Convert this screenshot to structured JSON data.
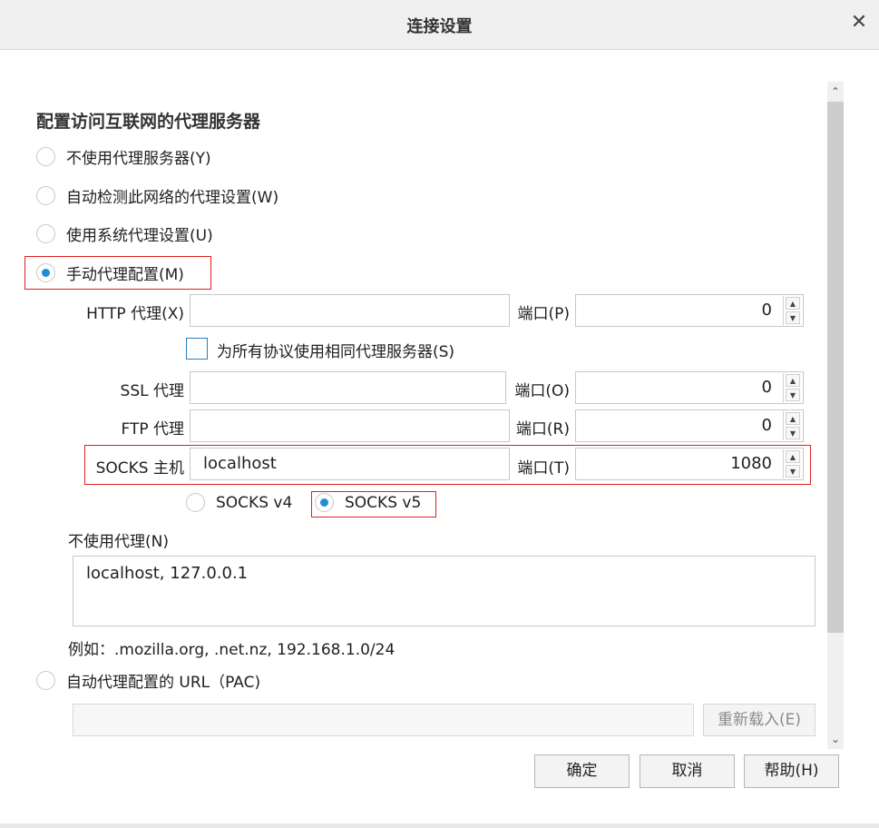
{
  "window": {
    "title": "连接设置",
    "close_glyph": "✕"
  },
  "section": {
    "title": "配置访问互联网的代理服务器"
  },
  "proxy_modes": [
    {
      "label": "不使用代理服务器(Y)",
      "checked": false
    },
    {
      "label": "自动检测此网络的代理设置(W)",
      "checked": false
    },
    {
      "label": "使用系统代理设置(U)",
      "checked": false
    },
    {
      "label": "手动代理配置(M)",
      "checked": true
    }
  ],
  "manual": {
    "http": {
      "label": "HTTP 代理(X)",
      "value": "",
      "port_label": "端口(P)",
      "port": "0"
    },
    "same_proxy_checkbox": {
      "label": "为所有协议使用相同代理服务器(S)",
      "checked": false
    },
    "ssl": {
      "label": "SSL 代理",
      "value": "",
      "port_label": "端口(O)",
      "port": "0"
    },
    "ftp": {
      "label": "FTP 代理",
      "value": "",
      "port_label": "端口(R)",
      "port": "0"
    },
    "socks": {
      "label": "SOCKS 主机",
      "value": "localhost",
      "port_label": "端口(T)",
      "port": "1080"
    },
    "socks_versions": [
      {
        "label": "SOCKS v4",
        "checked": false
      },
      {
        "label": "SOCKS v5",
        "checked": true
      }
    ]
  },
  "no_proxy": {
    "label": "不使用代理(N)",
    "value": "localhost, 127.0.0.1",
    "example": "例如：.mozilla.org, .net.nz, 192.168.1.0/24"
  },
  "pac": {
    "label": "自动代理配置的 URL（PAC)",
    "checked": false,
    "value": "",
    "reload_label": "重新载入(E)"
  },
  "buttons": {
    "ok": "确定",
    "cancel": "取消",
    "help": "帮助(H)"
  },
  "icons": {
    "spin_up": "▲",
    "spin_down": "▼",
    "scroll_up": "⌃",
    "scroll_down": "⌄"
  },
  "colors": {
    "accent": "#1e8fd6",
    "highlight_box": "#e02020"
  }
}
